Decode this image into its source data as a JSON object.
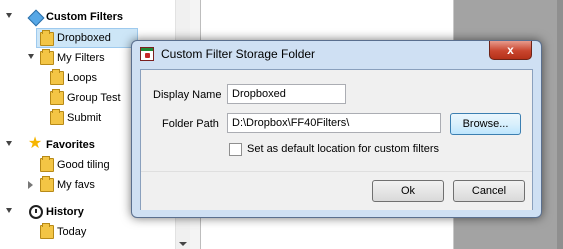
{
  "tree": {
    "custom_filters": "Custom Filters",
    "dropboxed": "Dropboxed",
    "my_filters": "My Filters",
    "loops": "Loops",
    "group_test": "Group Test",
    "submit": "Submit",
    "favorites": "Favorites",
    "good_tiling": "Good tiling",
    "my_favs": "My favs",
    "history": "History",
    "today": "Today"
  },
  "dialog": {
    "title": "Custom Filter Storage Folder",
    "close_label": "x",
    "display_name_label": "Display Name",
    "display_name_value": "Dropboxed",
    "folder_path_label": "Folder Path",
    "folder_path_value": "D:\\Dropbox\\FF40Filters\\",
    "browse_label": "Browse...",
    "default_checkbox_label": "Set as default location for custom filters",
    "default_checked": false,
    "ok_label": "Ok",
    "cancel_label": "Cancel"
  },
  "colors": {
    "selection": "#cde6f7",
    "dialog_frame": "#cfe0f3",
    "close_button": "#c9452e"
  }
}
